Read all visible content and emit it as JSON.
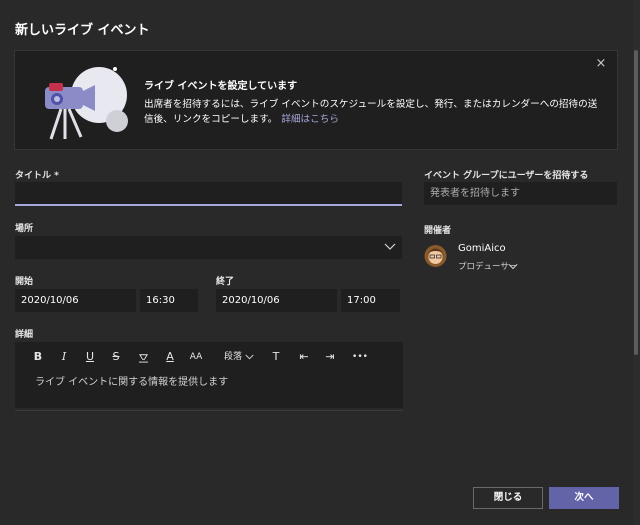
{
  "dialog": {
    "title": "新しいライブ イベント"
  },
  "banner": {
    "heading": "ライブ イベントを設定しています",
    "body": "出席者を招待するには、ライブ イベントのスケジュールを設定し、発行、またはカレンダーへの招待の送信後、リンクをコピーします。",
    "link": "詳細はこちら",
    "close_icon": "×"
  },
  "form": {
    "title_label": "タイトル *",
    "title_value": "",
    "location_label": "場所",
    "location_value": "",
    "start_label": "開始",
    "start_date": "2020/10/06",
    "start_time": "16:30",
    "end_label": "終了",
    "end_date": "2020/10/06",
    "end_time": "17:00",
    "details_label": "詳細",
    "details_placeholder": "ライブ イベントに関する情報を提供します"
  },
  "toolbar": {
    "bold": "B",
    "italic": "I",
    "underline": "U",
    "strike": "S",
    "highlight": "🝖",
    "font_color": "A",
    "font_size": "AA",
    "paragraph": "段落",
    "clear_format": "T",
    "outdent": "⇤",
    "indent": "⇥",
    "more": "•••"
  },
  "invite": {
    "label": "イベント グループにユーザーを招待する",
    "placeholder": "発表者を招待します"
  },
  "organizer": {
    "label": "開催者",
    "name": "GomiAico",
    "role": "プロデューサー"
  },
  "buttons": {
    "close": "閉じる",
    "next": "次へ"
  },
  "colors": {
    "background": "#292929",
    "field": "#1f1f1f",
    "accent": "#6264a7",
    "link": "#a6a7dc"
  }
}
